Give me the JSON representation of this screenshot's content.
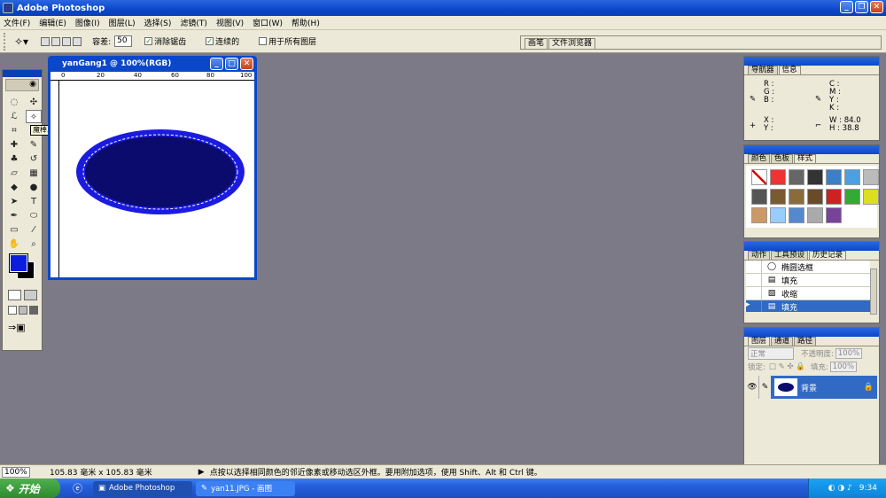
{
  "app": {
    "title": "Adobe Photoshop"
  },
  "menu": [
    "文件(F)",
    "编辑(E)",
    "图像(I)",
    "图层(L)",
    "选择(S)",
    "滤镜(T)",
    "视图(V)",
    "窗口(W)",
    "帮助(H)"
  ],
  "options": {
    "tolerance_label": "容差:",
    "tolerance_value": "50",
    "antialias_label": "消除锯齿",
    "contiguous_label": "连续的",
    "all_layers_label": "用于所有图层"
  },
  "well_tabs": [
    "画笔",
    "文件浏览器"
  ],
  "tooltip": "魔棒工具(W)",
  "document": {
    "title": "yanGang1 @ 100%(RGB)",
    "ruler_marks": [
      "0",
      "20",
      "40",
      "60",
      "80",
      "100"
    ]
  },
  "panels": {
    "navigator": {
      "tabs": [
        "导航器",
        "信息"
      ],
      "rgb": [
        "R :",
        "G :",
        "B :"
      ],
      "cmyk": [
        "C :",
        "M :",
        "Y :",
        "K :"
      ],
      "xy": [
        "X :",
        "Y :"
      ],
      "wh_labels": [
        "W :",
        "H :"
      ],
      "w": "84.0",
      "h": "38.8"
    },
    "color": {
      "tabs": [
        "颜色",
        "色板",
        "样式"
      ]
    },
    "history": {
      "tabs": [
        "动作",
        "工具预设",
        "历史记录"
      ],
      "items": [
        "椭圆选框",
        "填充",
        "收缩",
        "填充"
      ]
    },
    "layers": {
      "tabs": [
        "图层",
        "通道",
        "路径"
      ],
      "blend_mode": "正常",
      "opacity_label": "不透明度:",
      "opacity": "100%",
      "lock_label": "锁定:",
      "fill_label": "填充:",
      "fill": "100%",
      "layer_name": "背景"
    }
  },
  "status": {
    "zoom": "100%",
    "size": "105.83 毫米 x 105.83 毫米",
    "hint": "点按以选择相同颜色的邻近像素或移动选区外框。要用附加选项，使用 Shift、Alt 和 Ctrl 键。"
  },
  "taskbar": {
    "start": "开始",
    "tasks": [
      "Adobe Photoshop",
      "yan11.JPG - 画图"
    ],
    "clock": "9:34"
  },
  "colors": {
    "foreground": "#0b1ee0",
    "ellipse_fill": "#0b0b6e",
    "ellipse_ring": "#1b1bdf"
  }
}
